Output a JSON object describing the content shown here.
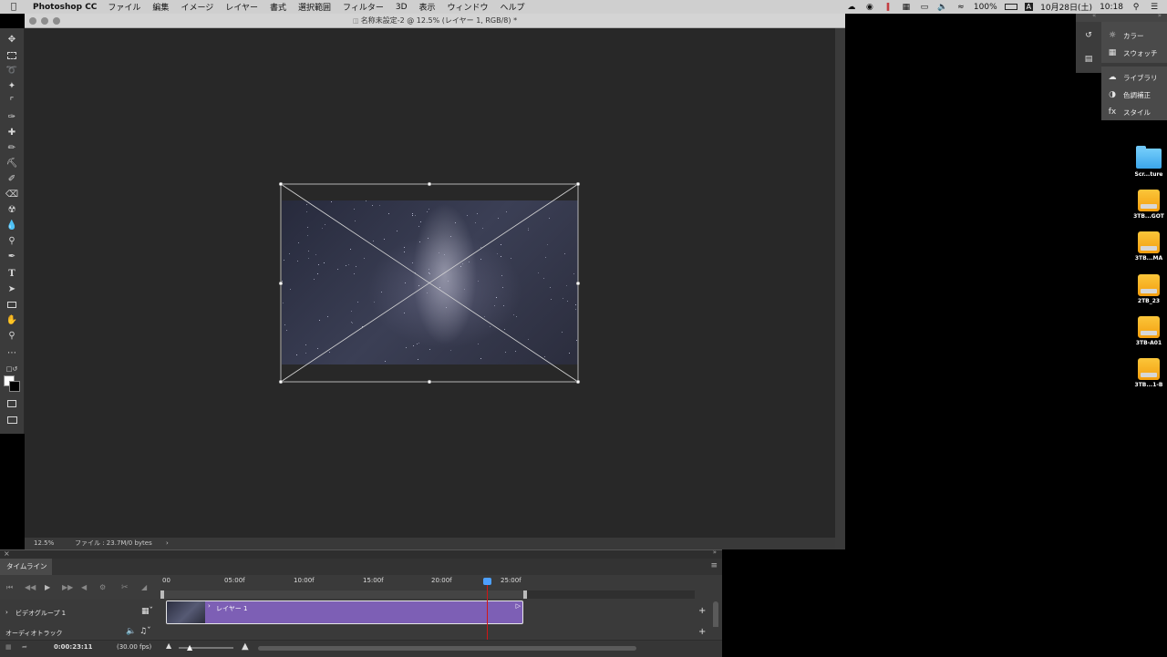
{
  "menubar": {
    "app_name": "Photoshop CC",
    "items": [
      "ファイル",
      "編集",
      "イメージ",
      "レイヤー",
      "書式",
      "選択範囲",
      "フィルター",
      "3D",
      "表示",
      "ウィンドウ",
      "ヘルプ"
    ],
    "battery": "100%",
    "input_mode": "A",
    "date": "10月28日(土)",
    "time": "10:18"
  },
  "document": {
    "title": "名称未設定-2 @ 12.5% (レイヤー 1, RGB/8) *",
    "zoom": "12.5%",
    "file_info": "ファイル : 23.7M/0 bytes"
  },
  "right_panel": {
    "items": [
      {
        "label": "カラー",
        "icon": "color-wheel-icon"
      },
      {
        "label": "スウォッチ",
        "icon": "swatches-grid-icon"
      },
      {
        "label": "ライブラリ",
        "icon": "cc-libraries-icon"
      },
      {
        "label": "色調補正",
        "icon": "adjustments-icon"
      },
      {
        "label": "スタイル",
        "icon": "styles-icon"
      }
    ]
  },
  "desktop": {
    "icons": [
      {
        "label": "Scr...ture",
        "kind": "folder"
      },
      {
        "label": "3TB...GOT",
        "kind": "drive"
      },
      {
        "label": "3TB...MA",
        "kind": "drive"
      },
      {
        "label": "2TB_23",
        "kind": "drive"
      },
      {
        "label": "3TB-A01",
        "kind": "drive"
      },
      {
        "label": "3TB...1-B",
        "kind": "drive"
      }
    ]
  },
  "timeline": {
    "tab_label": "タイムライン",
    "ruler_ticks": [
      "00",
      "05:00f",
      "10:00f",
      "15:00f",
      "20:00f",
      "25:00f"
    ],
    "video_group": "ビデオグループ 1",
    "clip_label": "レイヤー 1",
    "audio_track": "オーディオトラック",
    "current_time": "0:00:23:11",
    "fps": "(30.00 fps)"
  },
  "colors": {
    "clip": "#7d5fb5",
    "playhead": "#d01616",
    "playhead_knob": "#4da0ff",
    "drive": "#f5a623",
    "folder": "#5bb8f4"
  }
}
